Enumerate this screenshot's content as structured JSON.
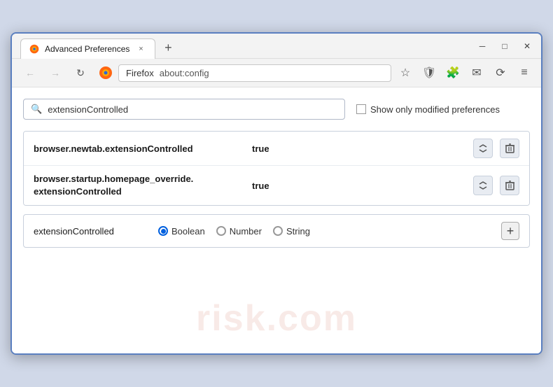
{
  "window": {
    "title": "Advanced Preferences",
    "tab_close": "×",
    "new_tab": "+",
    "win_minimize": "─",
    "win_restore": "□",
    "win_close": "✕"
  },
  "toolbar": {
    "back_label": "←",
    "forward_label": "→",
    "reload_label": "↻",
    "browser_name": "Firefox",
    "url": "about:config",
    "bookmark_icon": "☆",
    "shield_icon": "🛡",
    "extension_icon": "🧩",
    "lock_icon": "✉",
    "sync_icon": "⟳",
    "menu_icon": "≡"
  },
  "search": {
    "value": "extensionControlled",
    "placeholder": "extensionControlled",
    "show_modified_label": "Show only modified preferences"
  },
  "results": [
    {
      "name": "browser.newtab.extensionControlled",
      "value": "true"
    },
    {
      "name_line1": "browser.startup.homepage_override.",
      "name_line2": "extensionControlled",
      "value": "true"
    }
  ],
  "add_row": {
    "name": "extensionControlled",
    "types": [
      "Boolean",
      "Number",
      "String"
    ],
    "selected_type": "Boolean"
  },
  "watermark": "risk.com"
}
